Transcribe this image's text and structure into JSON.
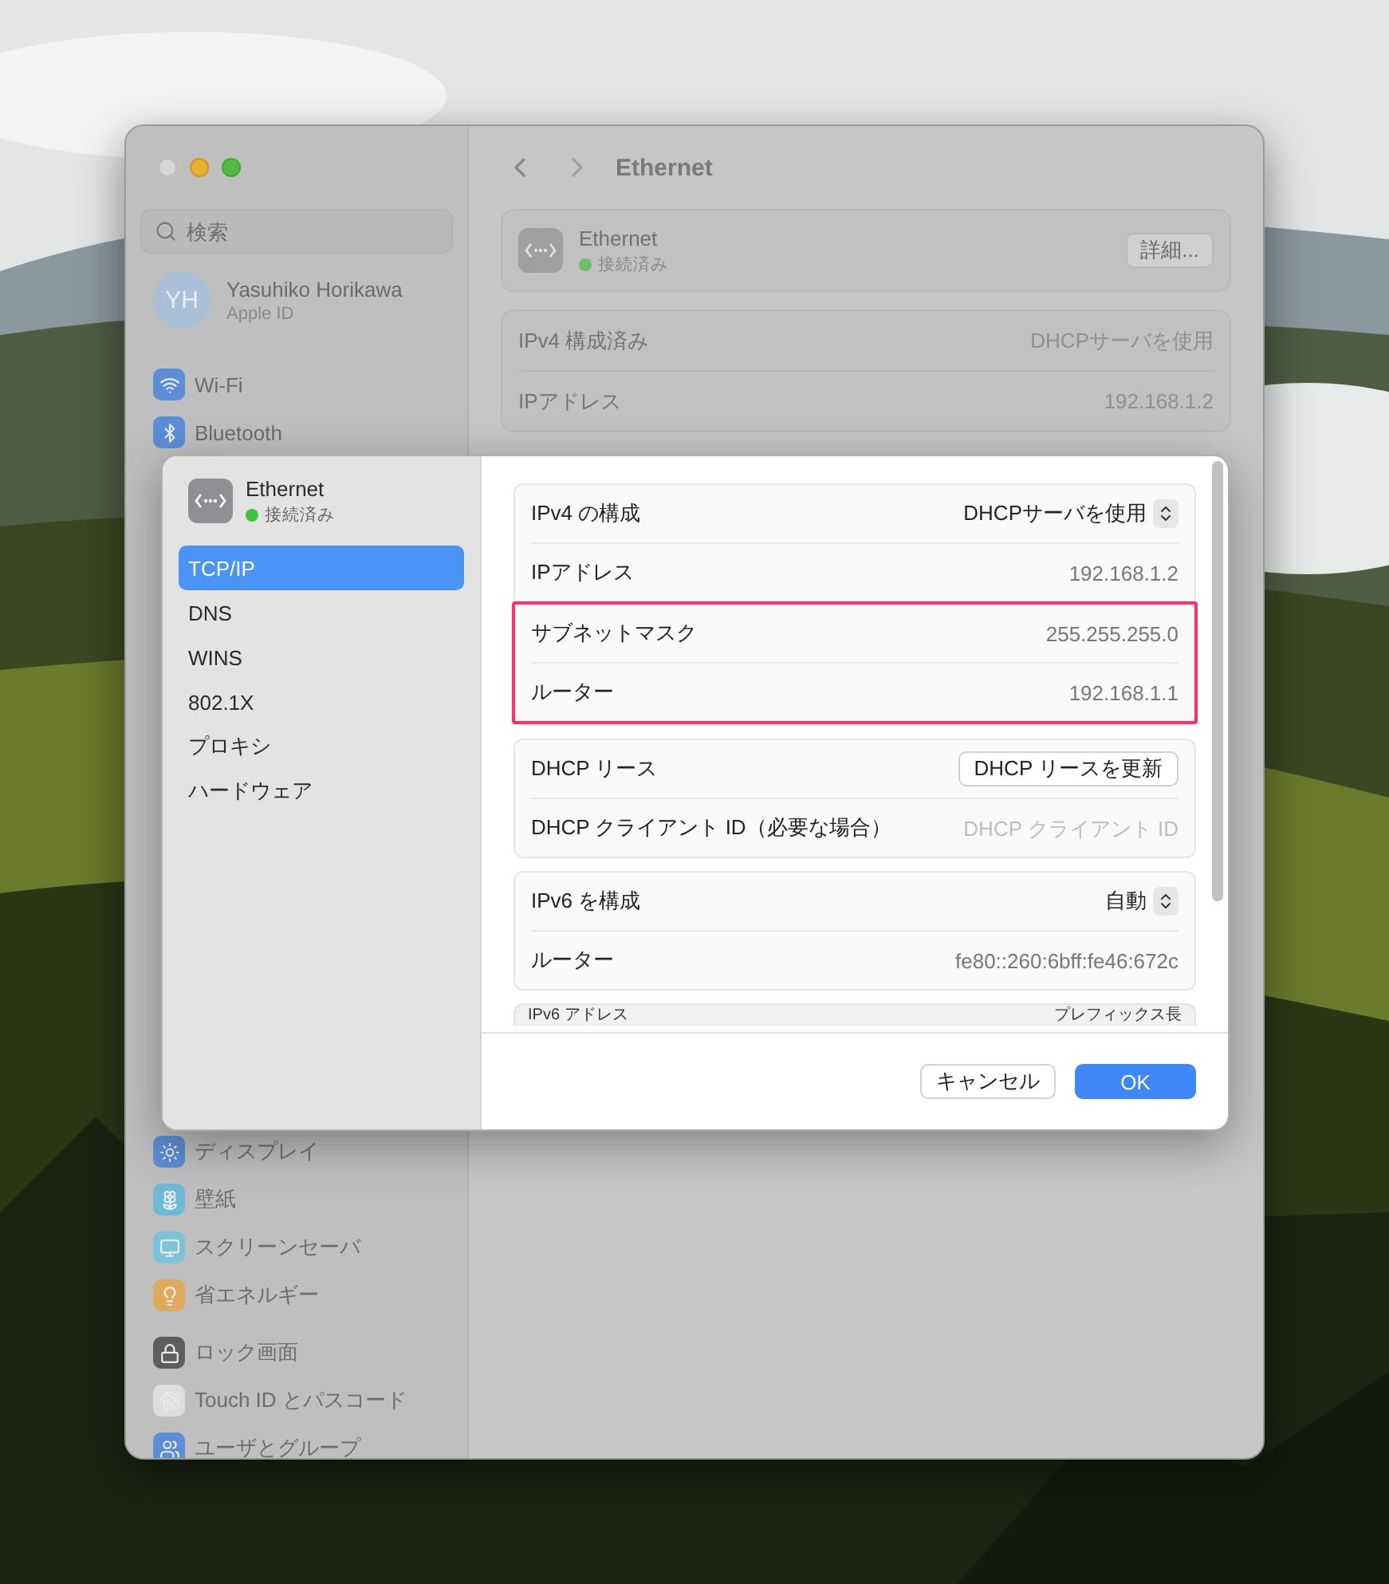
{
  "window": {
    "toolbar_title": "Ethernet"
  },
  "search": {
    "placeholder": "検索"
  },
  "account": {
    "initials": "YH",
    "name": "Yasuhiko Horikawa",
    "subtitle": "Apple ID"
  },
  "sidebar": {
    "groups": [
      {
        "items": [
          {
            "label": "Wi-Fi",
            "color": "#5b8ed6"
          },
          {
            "label": "Bluetooth",
            "color": "#5b8ed6"
          }
        ]
      },
      {
        "items": [
          {
            "label": "ディスプレイ",
            "color": "#5b8ed6"
          },
          {
            "label": "壁紙",
            "color": "#6cbad6"
          },
          {
            "label": "スクリーンセーバ",
            "color": "#7cc2d8"
          },
          {
            "label": "省エネルギー",
            "color": "#deaa5c"
          }
        ]
      },
      {
        "items": [
          {
            "label": "ロック画面",
            "color": "#5e5e5e"
          },
          {
            "label": "Touch ID とパスコード",
            "color": "#dedede"
          },
          {
            "label": "ユーザとグループ",
            "color": "#5b8ed6"
          }
        ]
      }
    ]
  },
  "service": {
    "name": "Ethernet",
    "status": "接続済み",
    "details_button": "詳細...",
    "rows": [
      {
        "label": "IPv4 構成済み",
        "value": "DHCPサーバを使用"
      },
      {
        "label": "IPアドレス",
        "value": "192.168.1.2"
      }
    ]
  },
  "dialog": {
    "name": "Ethernet",
    "status": "接続済み",
    "tabs": [
      {
        "label": "TCP/IP",
        "selected": true
      },
      {
        "label": "DNS",
        "selected": false
      },
      {
        "label": "WINS",
        "selected": false
      },
      {
        "label": "802.1X",
        "selected": false
      },
      {
        "label": "プロキシ",
        "selected": false
      },
      {
        "label": "ハードウェア",
        "selected": false
      }
    ],
    "groups": [
      {
        "rows": [
          {
            "kind": "popup",
            "label": "IPv4 の構成",
            "value": "DHCPサーバを使用",
            "highlighted": false
          },
          {
            "kind": "text",
            "label": "IPアドレス",
            "value": "192.168.1.2",
            "highlighted": false
          },
          {
            "kind": "text",
            "label": "サブネットマスク",
            "value": "255.255.255.0",
            "highlighted": true
          },
          {
            "kind": "text",
            "label": "ルーター",
            "value": "192.168.1.1",
            "highlighted": true
          }
        ]
      },
      {
        "rows": [
          {
            "kind": "button",
            "label": "DHCP リース",
            "value": "DHCP リースを更新",
            "highlighted": false
          },
          {
            "kind": "field",
            "label": "DHCP クライアント ID（必要な場合）",
            "placeholder": "DHCP クライアント ID",
            "highlighted": false
          }
        ]
      },
      {
        "rows": [
          {
            "kind": "popup",
            "label": "IPv6 を構成",
            "value": "自動",
            "highlighted": false
          },
          {
            "kind": "text",
            "label": "ルーター",
            "value": "fe80::260:6bff:fe46:672c",
            "highlighted": false
          }
        ]
      }
    ],
    "table_columns": [
      "IPv6 アドレス",
      "プレフィックス長"
    ],
    "buttons": [
      {
        "label": "キャンセル",
        "primary": false
      },
      {
        "label": "OK",
        "primary": true
      }
    ]
  }
}
